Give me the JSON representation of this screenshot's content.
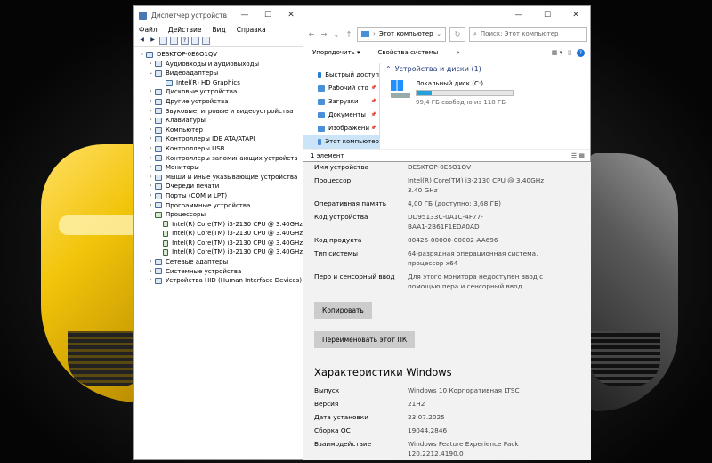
{
  "device_manager": {
    "title": "Диспетчер устройств",
    "menu": [
      "Файл",
      "Действие",
      "Вид",
      "Справка"
    ],
    "tree": [
      {
        "level": 0,
        "label": "DESKTOP-0E6O1QV",
        "arrow": "⌄",
        "icon": "computer-icon"
      },
      {
        "level": 1,
        "label": "Аудиовходы и аудиовыходы",
        "arrow": "›",
        "icon": "audio-icon"
      },
      {
        "level": 1,
        "label": "Видеоадаптеры",
        "arrow": "⌄",
        "icon": "display-adapter-icon"
      },
      {
        "level": 2,
        "label": "Intel(R) HD Graphics",
        "arrow": "",
        "icon": "display-adapter-icon"
      },
      {
        "level": 1,
        "label": "Дисковые устройства",
        "arrow": "›",
        "icon": "disk-icon"
      },
      {
        "level": 1,
        "label": "Другие устройства",
        "arrow": "›",
        "icon": "other-device-icon"
      },
      {
        "level": 1,
        "label": "Звуковые, игровые и видеоустройства",
        "arrow": "›",
        "icon": "sound-icon"
      },
      {
        "level": 1,
        "label": "Клавиатуры",
        "arrow": "›",
        "icon": "keyboard-icon"
      },
      {
        "level": 1,
        "label": "Компьютер",
        "arrow": "›",
        "icon": "computer-icon"
      },
      {
        "level": 1,
        "label": "Контроллеры IDE ATA/ATAPI",
        "arrow": "›",
        "icon": "ide-icon"
      },
      {
        "level": 1,
        "label": "Контроллеры USB",
        "arrow": "›",
        "icon": "usb-icon"
      },
      {
        "level": 1,
        "label": "Контроллеры запоминающих устройств",
        "arrow": "›",
        "icon": "storage-icon"
      },
      {
        "level": 1,
        "label": "Мониторы",
        "arrow": "›",
        "icon": "monitor-icon"
      },
      {
        "level": 1,
        "label": "Мыши и иные указывающие устройства",
        "arrow": "›",
        "icon": "mouse-icon"
      },
      {
        "level": 1,
        "label": "Очереди печати",
        "arrow": "›",
        "icon": "printer-icon"
      },
      {
        "level": 1,
        "label": "Порты (COM и LPT)",
        "arrow": "›",
        "icon": "port-icon"
      },
      {
        "level": 1,
        "label": "Программные устройства",
        "arrow": "›",
        "icon": "software-device-icon"
      },
      {
        "level": 1,
        "label": "Процессоры",
        "arrow": "⌄",
        "icon": "cpu-icon"
      },
      {
        "level": 2,
        "label": "Intel(R) Core(TM) i3-2130 CPU @ 3.40GHz",
        "arrow": "",
        "icon": "cpu-icon"
      },
      {
        "level": 2,
        "label": "Intel(R) Core(TM) i3-2130 CPU @ 3.40GHz",
        "arrow": "",
        "icon": "cpu-icon"
      },
      {
        "level": 2,
        "label": "Intel(R) Core(TM) i3-2130 CPU @ 3.40GHz",
        "arrow": "",
        "icon": "cpu-icon"
      },
      {
        "level": 2,
        "label": "Intel(R) Core(TM) i3-2130 CPU @ 3.40GHz",
        "arrow": "",
        "icon": "cpu-icon"
      },
      {
        "level": 1,
        "label": "Сетевые адаптеры",
        "arrow": "›",
        "icon": "network-icon"
      },
      {
        "level": 1,
        "label": "Системные устройства",
        "arrow": "›",
        "icon": "system-device-icon"
      },
      {
        "level": 1,
        "label": "Устройства HID (Human Interface Devices)",
        "arrow": "›",
        "icon": "hid-icon"
      }
    ]
  },
  "explorer": {
    "address": "Этот компьютер",
    "search_placeholder": "Поиск: Этот компьютер",
    "ribbon": {
      "organize": "Упорядочить",
      "system_props": "Свойства системы"
    },
    "nav": [
      {
        "label": "Быстрый доступ",
        "pinned": false,
        "selected": false
      },
      {
        "label": "Рабочий сто",
        "pinned": true,
        "selected": false
      },
      {
        "label": "Загрузки",
        "pinned": true,
        "selected": false
      },
      {
        "label": "Документы",
        "pinned": true,
        "selected": false
      },
      {
        "label": "Изображени",
        "pinned": true,
        "selected": false
      },
      {
        "label": "Этот компьютер",
        "pinned": false,
        "selected": true
      }
    ],
    "group_header": "Устройства и диски (1)",
    "drive": {
      "name": "Локальный диск (C:)",
      "free": "99,4 ГБ свободно из 118 ГБ",
      "used_fraction": 0.16
    },
    "status": "1 элемент"
  },
  "about": {
    "device_specs": [
      {
        "key": "Имя устройства",
        "value": "DESKTOP-0E6O1QV"
      },
      {
        "key": "Процессор",
        "value": "Intel(R) Core(TM) i3-2130 CPU @ 3.40GHz\n3.40 GHz"
      },
      {
        "key": "Оперативная память",
        "value": "4,00 ГБ (доступно: 3,68 ГБ)"
      },
      {
        "key": "Код устройства",
        "value": "DD95133C-0A1C-4F77-\nBAA1-2B61F1EDA0AD"
      },
      {
        "key": "Код продукта",
        "value": "00425-00000-00002-AA696"
      },
      {
        "key": "Тип системы",
        "value": "64-разрядная операционная система,\nпроцессор x64"
      },
      {
        "key": "Перо и сенсорный ввод",
        "value": "Для этого монитора недоступен ввод с\nпомощью пера и сенсорный ввод"
      }
    ],
    "copy_button": "Копировать",
    "rename_button": "Переименовать этот ПК",
    "windows_title": "Характеристики Windows",
    "windows_specs": [
      {
        "key": "Выпуск",
        "value": "Windows 10 Корпоративная LTSC"
      },
      {
        "key": "Версия",
        "value": "21H2"
      },
      {
        "key": "Дата установки",
        "value": "23.07.2025"
      },
      {
        "key": "Сборка ОС",
        "value": "19044.2846"
      },
      {
        "key": "Взаимодействие",
        "value": "Windows Feature Experience Pack\n120.2212.4190.0"
      }
    ]
  }
}
